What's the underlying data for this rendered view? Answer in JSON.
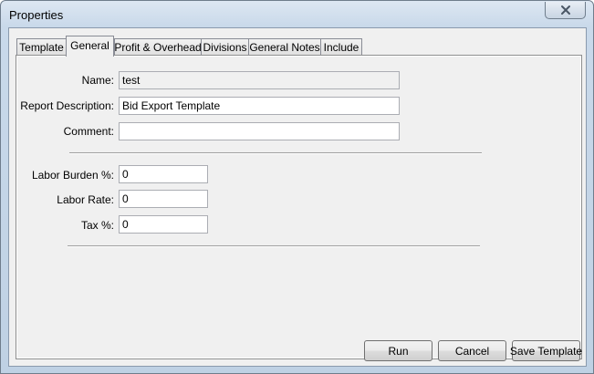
{
  "window": {
    "title": "Properties",
    "close_icon": "close-icon"
  },
  "tabs": [
    {
      "label": "Template",
      "active": false
    },
    {
      "label": "General",
      "active": true
    },
    {
      "label": "Profit & Overhead",
      "active": false
    },
    {
      "label": "Divisions",
      "active": false
    },
    {
      "label": "General Notes",
      "active": false
    },
    {
      "label": "Include",
      "active": false
    }
  ],
  "general": {
    "name": {
      "label": "Name:",
      "value": "test"
    },
    "report_description": {
      "label": "Report Description:",
      "value": "Bid Export Template"
    },
    "comment": {
      "label": "Comment:",
      "value": ""
    },
    "labor_burden": {
      "label": "Labor Burden %:",
      "value": "0"
    },
    "labor_rate": {
      "label": "Labor Rate:",
      "value": "0"
    },
    "tax": {
      "label": "Tax %:",
      "value": "0"
    }
  },
  "buttons": {
    "run": "Run",
    "cancel": "Cancel",
    "save_template": "Save Template"
  }
}
